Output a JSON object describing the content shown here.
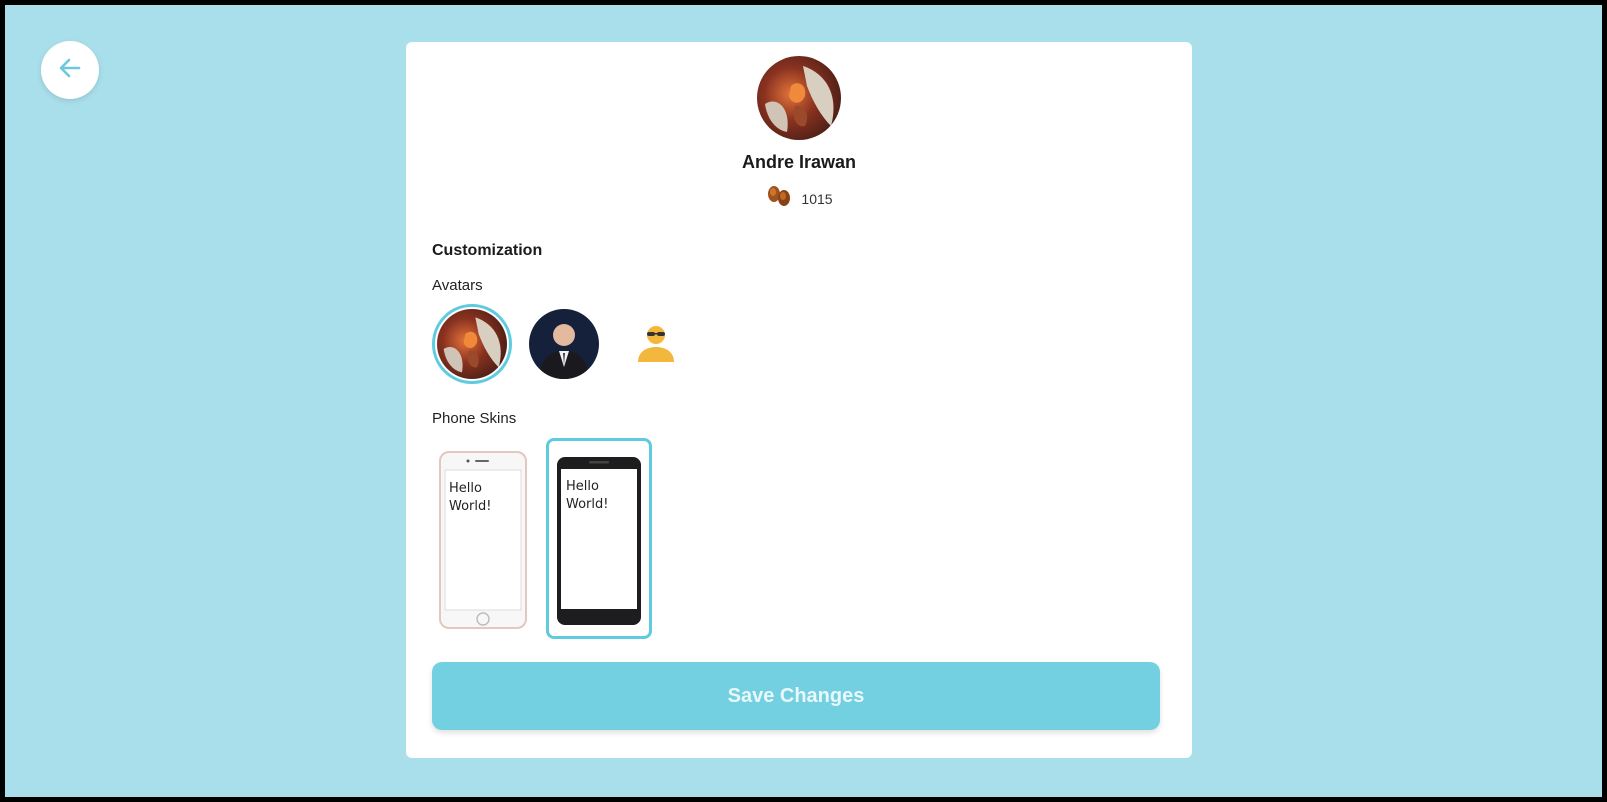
{
  "nav": {
    "back_icon": "arrow-left-icon"
  },
  "profile": {
    "name": "Andre Irawan",
    "coins": "1015",
    "coins_icon": "coins-icon"
  },
  "customization": {
    "title": "Customization",
    "avatars_label": "Avatars",
    "avatars": [
      {
        "name": "fantasy-art-avatar",
        "selected": true
      },
      {
        "name": "man-in-suit-avatar",
        "selected": false
      },
      {
        "name": "sunglasses-person-icon",
        "selected": false
      }
    ],
    "phone_skins_label": "Phone Skins",
    "phone_skins": [
      {
        "name": "white-iphone-skin",
        "text_line1": "Hello",
        "text_line2": "World!",
        "selected": false
      },
      {
        "name": "black-android-skin",
        "text_line1": "Hello",
        "text_line2": "World!",
        "selected": true
      }
    ]
  },
  "actions": {
    "save_label": "Save Changes"
  },
  "colors": {
    "background": "#a9dfeb",
    "accent": "#5fcbe0",
    "button": "#72d0e1"
  }
}
